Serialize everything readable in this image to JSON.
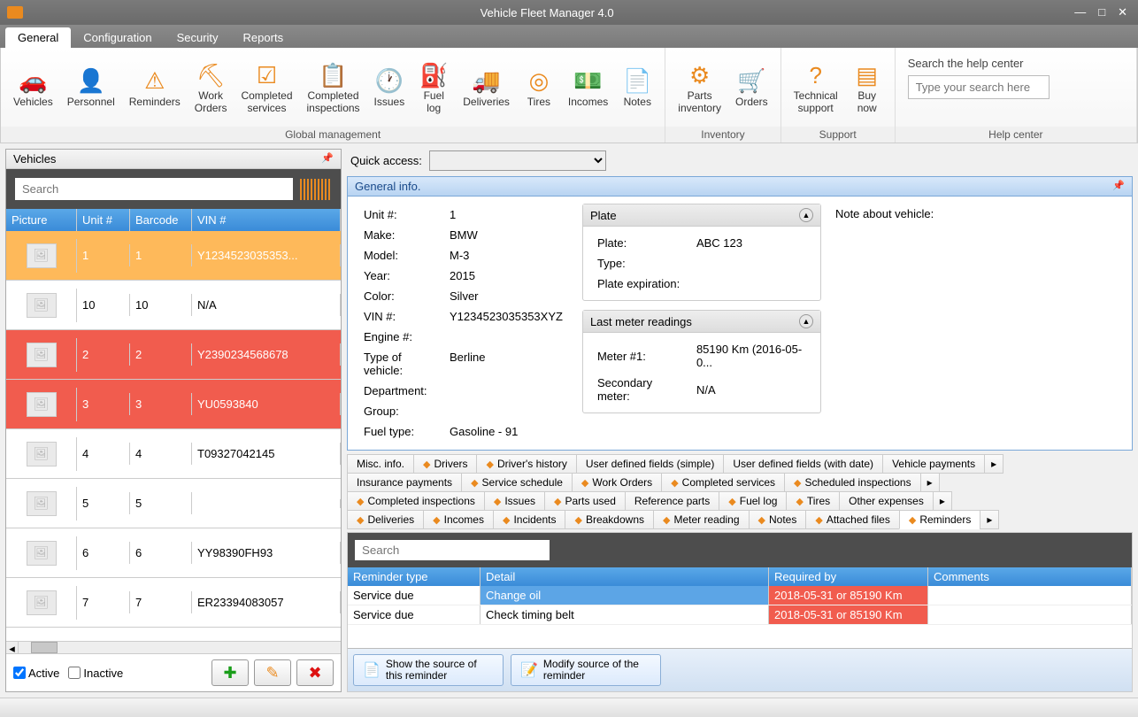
{
  "window": {
    "title": "Vehicle Fleet Manager 4.0"
  },
  "tabs": [
    "General",
    "Configuration",
    "Security",
    "Reports"
  ],
  "ribbon": {
    "group1_label": "Global management",
    "group2_label": "Inventory",
    "group3_label": "Support",
    "group4_label": "Help center",
    "items_g1": [
      {
        "icon": "🚗",
        "label": "Vehicles"
      },
      {
        "icon": "👤",
        "label": "Personnel"
      },
      {
        "icon": "⚠",
        "label": "Reminders"
      },
      {
        "icon": "⛏",
        "label": "Work\nOrders"
      },
      {
        "icon": "☑",
        "label": "Completed\nservices"
      },
      {
        "icon": "📋",
        "label": "Completed\ninspections"
      },
      {
        "icon": "🕐",
        "label": "Issues"
      },
      {
        "icon": "⛽",
        "label": "Fuel\nlog"
      },
      {
        "icon": "🚚",
        "label": "Deliveries"
      },
      {
        "icon": "◎",
        "label": "Tires"
      },
      {
        "icon": "💵",
        "label": "Incomes"
      },
      {
        "icon": "📄",
        "label": "Notes"
      }
    ],
    "items_g2": [
      {
        "icon": "⚙",
        "label": "Parts\ninventory"
      },
      {
        "icon": "🛒",
        "label": "Orders"
      }
    ],
    "items_g3": [
      {
        "icon": "?",
        "label": "Technical\nsupport"
      },
      {
        "icon": "▤",
        "label": "Buy\nnow"
      }
    ],
    "help_label": "Search the help center",
    "help_placeholder": "Type your search here"
  },
  "leftpanel": {
    "title": "Vehicles",
    "search_placeholder": "Search",
    "columns": [
      "Picture",
      "Unit #",
      "Barcode",
      "VIN #"
    ],
    "rows": [
      {
        "unit": "1",
        "bc": "1",
        "vin": "Y1234523035353...",
        "sel": true
      },
      {
        "unit": "10",
        "bc": "10",
        "vin": "N/A"
      },
      {
        "unit": "2",
        "bc": "2",
        "vin": "Y2390234568678",
        "red": true
      },
      {
        "unit": "3",
        "bc": "3",
        "vin": "YU0593840",
        "red": true
      },
      {
        "unit": "4",
        "bc": "4",
        "vin": "T09327042145"
      },
      {
        "unit": "5",
        "bc": "5",
        "vin": ""
      },
      {
        "unit": "6",
        "bc": "6",
        "vin": "YY98390FH93"
      },
      {
        "unit": "7",
        "bc": "7",
        "vin": "ER23394083057"
      }
    ],
    "active_label": "Active",
    "inactive_label": "Inactive"
  },
  "quick_access_label": "Quick access:",
  "general_info": {
    "header": "General info.",
    "fields": {
      "unit_l": "Unit #:",
      "unit_v": "1",
      "make_l": "Make:",
      "make_v": "BMW",
      "model_l": "Model:",
      "model_v": "M-3",
      "year_l": "Year:",
      "year_v": "2015",
      "color_l": "Color:",
      "color_v": "Silver",
      "vin_l": "VIN #:",
      "vin_v": "Y1234523035353XYZ",
      "engine_l": "Engine #:",
      "engine_v": "",
      "tov_l": "Type of vehicle:",
      "tov_v": "Berline",
      "dept_l": "Department:",
      "dept_v": "",
      "group_l": "Group:",
      "group_v": "",
      "fuel_l": "Fuel type:",
      "fuel_v": "Gasoline - 91"
    },
    "plate": {
      "header": "Plate",
      "plate_l": "Plate:",
      "plate_v": "ABC 123",
      "type_l": "Type:",
      "type_v": "",
      "exp_l": "Plate expiration:",
      "exp_v": ""
    },
    "meter": {
      "header": "Last meter readings",
      "m1_l": "Meter #1:",
      "m1_v": "85190 Km (2016-05-0...",
      "m2_l": "Secondary meter:",
      "m2_v": "N/A"
    },
    "note_label": "Note about vehicle:"
  },
  "dettabs": [
    "Misc. info.",
    "Drivers",
    "Driver's history",
    "User defined fields (simple)",
    "User defined fields (with date)",
    "Vehicle payments",
    "Insurance payments",
    "Service schedule",
    "Work Orders",
    "Completed services",
    "Scheduled inspections",
    "Completed inspections",
    "Issues",
    "Parts used",
    "Reference parts",
    "Fuel log",
    "Tires",
    "Other expenses",
    "Deliveries",
    "Incomes",
    "Incidents",
    "Breakdowns",
    "Meter reading",
    "Notes",
    "Attached files",
    "Reminders"
  ],
  "reminders": {
    "search_placeholder": "Search",
    "columns": [
      "Reminder type",
      "Detail",
      "Required by",
      "Comments"
    ],
    "rows": [
      {
        "type": "Service due",
        "detail": "Change oil",
        "req": "2018-05-31 or 85190 Km",
        "sel": true
      },
      {
        "type": "Service due",
        "detail": "Check timing belt",
        "req": "2018-05-31 or 85190 Km"
      }
    ],
    "btn1": "Show the source of this reminder",
    "btn2": "Modify source of the reminder"
  }
}
